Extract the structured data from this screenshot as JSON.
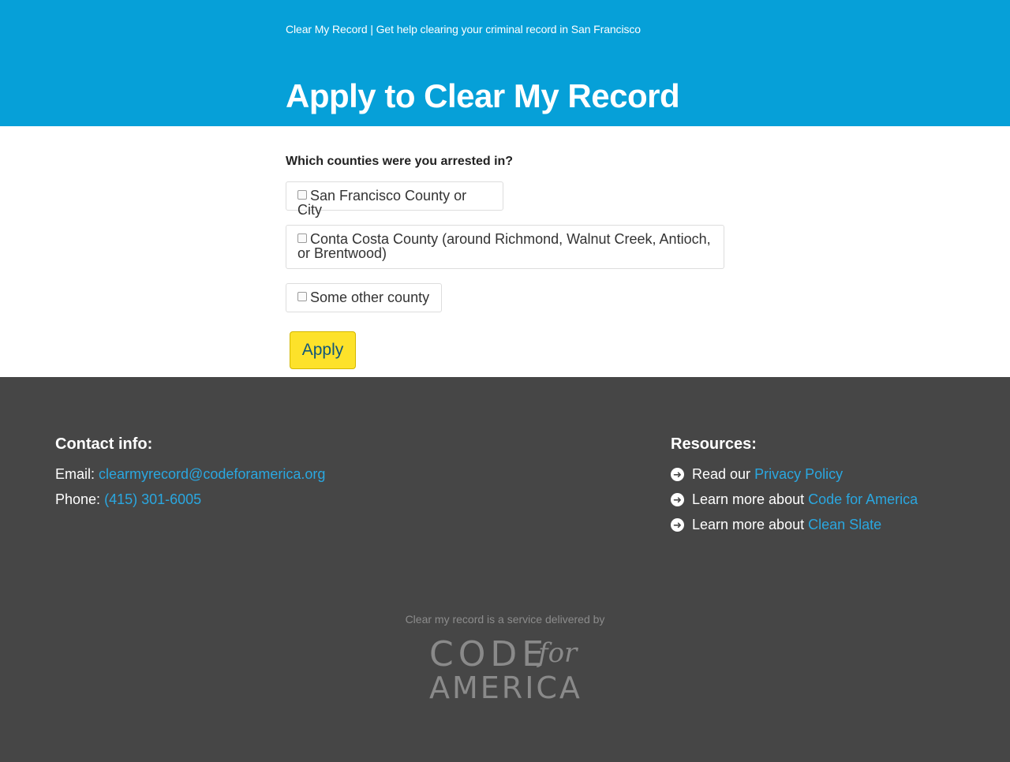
{
  "header": {
    "tagline": "Clear My Record | Get help clearing your criminal record in San Francisco",
    "title": "Apply to Clear My Record"
  },
  "form": {
    "question": "Which counties were you arrested in?",
    "options": [
      {
        "label": "San Francisco County or City",
        "checked": false
      },
      {
        "label": "Conta Costa County (around Richmond, Walnut Creek, Antioch, or Brentwood)",
        "checked": false
      },
      {
        "label": "Some other county",
        "checked": false
      }
    ],
    "submit_label": "Apply"
  },
  "footer": {
    "contact": {
      "heading": "Contact info:",
      "email_label": "Email:",
      "email": "clearmyrecord@codeforamerica.org",
      "phone_label": "Phone:",
      "phone": "(415) 301-6005"
    },
    "resources": {
      "heading": "Resources:",
      "items": [
        {
          "prefix": "Read our",
          "link": "Privacy Policy"
        },
        {
          "prefix": "Learn more about",
          "link": "Code for America"
        },
        {
          "prefix": "Learn more about",
          "link": "Clean Slate"
        }
      ]
    },
    "delivered_by": "Clear my record is a service delivered by",
    "logo": {
      "line1": "CODE",
      "for": "for",
      "line2": "AMERICA"
    }
  },
  "colors": {
    "header_bg": "#06a0d8",
    "footer_bg": "#464646",
    "link": "#2aa7e0",
    "button_bg": "#fde22a",
    "button_text": "#10567a"
  }
}
